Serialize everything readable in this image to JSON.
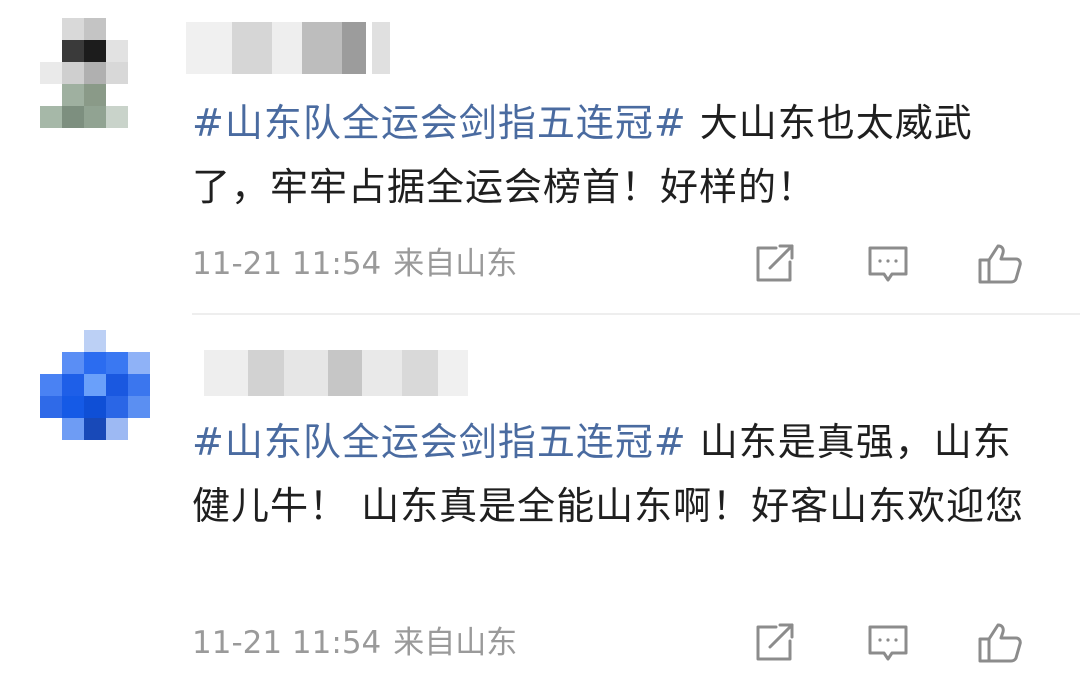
{
  "comments": [
    {
      "hashtag": "#山东队全运会剑指五连冠#",
      "text": " 大山东也太威武了，牢牢占据全运会榜首！好样的！",
      "date": "11-21 11:54",
      "location": "来自山东",
      "avatar_icon": "blurred-avatar",
      "username_state": "pixelated"
    },
    {
      "hashtag": "#山东队全运会剑指五连冠#",
      "text": " 山东是真强，山东健儿牛！ 山东真是全能山东啊！好客山东欢迎您",
      "date": "11-21 11:54",
      "location": "来自山东",
      "avatar_icon": "blurred-avatar",
      "username_state": "pixelated"
    }
  ],
  "actions": {
    "share_icon": "share-icon",
    "reply_icon": "comment-icon",
    "like_icon": "thumbs-up-icon"
  },
  "colors": {
    "hashtag": "#4a6ba0",
    "meta_text": "#9a9a9a",
    "icon": "#8c8c8c",
    "avatar2_accent": "#2b6cf0"
  }
}
